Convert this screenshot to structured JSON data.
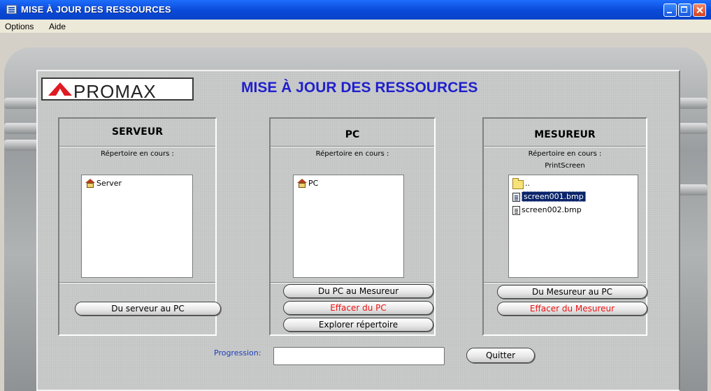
{
  "window": {
    "title": "MISE À JOUR DES RESSOURCES"
  },
  "menu": [
    {
      "label": "Options"
    },
    {
      "label": "Aide"
    }
  ],
  "logo": {
    "text": "PROMAX"
  },
  "heading": "MISE À JOUR DES RESSOURCES",
  "panels": {
    "server": {
      "title": "SERVEUR",
      "current_dir_label": "Répertoire en cours :",
      "current_dir": "",
      "items": [
        {
          "name": "Server",
          "icon": "house-icon"
        }
      ],
      "buttons": {
        "to_pc": "Du serveur au PC"
      }
    },
    "pc": {
      "title": "PC",
      "current_dir_label": "Répertoire en cours :",
      "current_dir": "",
      "items": [
        {
          "name": "PC",
          "icon": "house-icon"
        }
      ],
      "buttons": {
        "to_meter": "Du PC au Mesureur",
        "delete": "Effacer du PC",
        "explore": "Explorer répertoire"
      }
    },
    "meter": {
      "title": "MESUREUR",
      "current_dir_label": "Répertoire en cours :",
      "current_dir": "PrintScreen",
      "items": [
        {
          "name": "..",
          "icon": "folder-icon",
          "selected": false
        },
        {
          "name": "screen001.bmp",
          "icon": "file-icon",
          "selected": true
        },
        {
          "name": "screen002.bmp",
          "icon": "file-icon",
          "selected": false
        }
      ],
      "buttons": {
        "to_pc": "Du Mesureur au PC",
        "delete": "Effacer du Mesureur"
      }
    }
  },
  "progress": {
    "label": "Progression:",
    "value": ""
  },
  "quit_button": "Quitter",
  "colors": {
    "heading": "#1f1fcc",
    "danger": "#ee1111",
    "selection": "#0a246a",
    "titlebar": "#0a49d8"
  }
}
